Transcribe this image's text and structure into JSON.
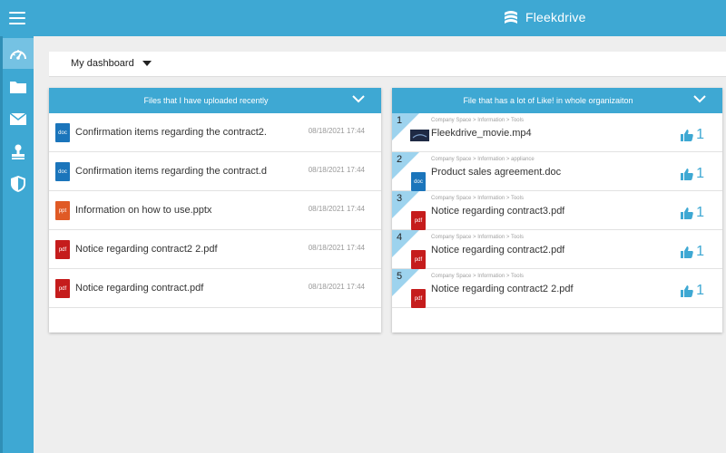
{
  "app": {
    "brand_name": "Fleekdrive"
  },
  "dashboard": {
    "selector_label": "My dashboard"
  },
  "panels": {
    "recent": {
      "title": "Files that I have uploaded recently",
      "items": [
        {
          "type": "doc",
          "type_label": "doc",
          "name": "Confirmation items regarding the contract2.",
          "date": "08/18/2021 17:44"
        },
        {
          "type": "doc",
          "type_label": "doc",
          "name": "Confirmation items regarding the contract.d",
          "date": "08/18/2021 17:44"
        },
        {
          "type": "ppt",
          "type_label": "ppt",
          "name": "Information on how to use.pptx",
          "date": "08/18/2021 17:44"
        },
        {
          "type": "pdf",
          "type_label": "pdf",
          "name": "Notice regarding contract2 2.pdf",
          "date": "08/18/2021 17:44"
        },
        {
          "type": "pdf",
          "type_label": "pdf",
          "name": "Notice regarding contract.pdf",
          "date": "08/18/2021 17:44"
        }
      ]
    },
    "liked": {
      "title": "File that has a lot of Like! in whole organizaiton",
      "items": [
        {
          "rank": "1",
          "path": "Company Space > Information > Tools",
          "type": "video",
          "type_label": "",
          "name": "Fleekdrive_movie.mp4",
          "likes": "1"
        },
        {
          "rank": "2",
          "path": "Company Space > Information > appliance",
          "type": "doc",
          "type_label": "doc",
          "name": "Product sales agreement.doc",
          "likes": "1"
        },
        {
          "rank": "3",
          "path": "Company Space > Information > Tools",
          "type": "pdf",
          "type_label": "pdf",
          "name": "Notice regarding contract3.pdf",
          "likes": "1"
        },
        {
          "rank": "4",
          "path": "Company Space > Information > Tools",
          "type": "pdf",
          "type_label": "pdf",
          "name": "Notice regarding contract2.pdf",
          "likes": "1"
        },
        {
          "rank": "5",
          "path": "Company Space > Information > Tools",
          "type": "pdf",
          "type_label": "pdf",
          "name": "Notice regarding contract2 2.pdf",
          "likes": "1"
        }
      ]
    }
  },
  "sidebar": {
    "items": [
      {
        "icon": "dashboard-icon",
        "active": true
      },
      {
        "icon": "folder-icon",
        "active": false
      },
      {
        "icon": "mail-icon",
        "active": false
      },
      {
        "icon": "stamp-icon",
        "active": false
      },
      {
        "icon": "shield-icon",
        "active": false
      }
    ]
  },
  "colors": {
    "primary": "#3ea8d3",
    "active_nav": "#75c2e3",
    "rank_badge": "#9dd3ee",
    "doc": "#1b75bb",
    "ppt": "#e05a25",
    "pdf": "#c51c1c"
  }
}
